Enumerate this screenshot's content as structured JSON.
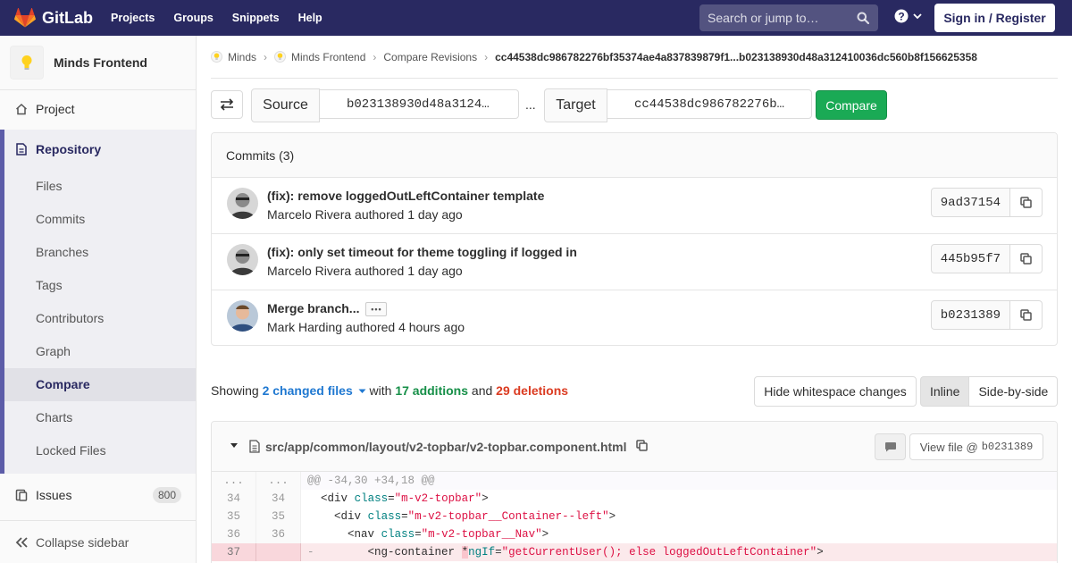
{
  "nav": {
    "brand": "GitLab",
    "links": [
      "Projects",
      "Groups",
      "Snippets",
      "Help"
    ],
    "search_placeholder": "Search or jump to…",
    "signin": "Sign in / Register"
  },
  "sidebar": {
    "project_name": "Minds Frontend",
    "project": "Project",
    "repository": "Repository",
    "repo_items": [
      "Files",
      "Commits",
      "Branches",
      "Tags",
      "Contributors",
      "Graph",
      "Compare",
      "Charts",
      "Locked Files"
    ],
    "active_item": "Compare",
    "issues": "Issues",
    "issues_count": "800",
    "collapse": "Collapse sidebar"
  },
  "breadcrumb": {
    "items": [
      "Minds",
      "Minds Frontend",
      "Compare Revisions"
    ],
    "current": "cc44538dc986782276bf35374ae4a837839879f1...b023138930d48a312410036dc560b8f156625358"
  },
  "compare": {
    "source_label": "Source",
    "source_value": "b023138930d48a3124…",
    "separator": "...",
    "target_label": "Target",
    "target_value": "cc44538dc986782276b…",
    "button": "Compare"
  },
  "commits": {
    "header": "Commits (3)",
    "items": [
      {
        "title": "(fix): remove loggedOutLeftContainer template",
        "author": "Marcelo Rivera",
        "meta": "authored 1 day ago",
        "sha": "9ad37154"
      },
      {
        "title": "(fix): only set timeout for theme toggling if logged in",
        "author": "Marcelo Rivera",
        "meta": "authored 1 day ago",
        "sha": "445b95f7"
      },
      {
        "title": "Merge branch...",
        "author": "Mark Harding",
        "meta": "authored 4 hours ago",
        "sha": "b0231389"
      }
    ]
  },
  "summary": {
    "showing": "Showing",
    "files": "2 changed files",
    "with": "with",
    "additions": "17 additions",
    "and": "and",
    "deletions": "29 deletions"
  },
  "toolbar": {
    "hide_whitespace": "Hide whitespace changes",
    "inline": "Inline",
    "side_by_side": "Side-by-side"
  },
  "file": {
    "path": "src/app/common/layout/v2-topbar/v2-topbar.component.html",
    "view_file": "View file @",
    "view_sha": "b0231389"
  },
  "diff": {
    "hunk": "@@ -34,30 +34,18 @@",
    "hunk_old": "...",
    "hunk_new": "...",
    "lines": [
      {
        "old": "34",
        "new": "34",
        "indent": "  ",
        "tag": "div",
        "attr": "class",
        "val": "\"m-v2-topbar\""
      },
      {
        "old": "35",
        "new": "35",
        "indent": "    ",
        "tag": "div",
        "attr": "class",
        "val": "\"m-v2-topbar__Container--left\""
      },
      {
        "old": "36",
        "new": "36",
        "indent": "      ",
        "tag": "nav",
        "attr": "class",
        "val": "\"m-v2-topbar__Nav\""
      }
    ],
    "deleted": {
      "old": "37",
      "marker": "-",
      "indent": "        ",
      "tag": "ng-container",
      "star": "*",
      "attr": "ngIf",
      "val": "\"getCurrentUser(); else loggedOutLeftContainer\""
    }
  },
  "colors": {
    "navbar": "#292961",
    "accent": "#1aaa55",
    "additions": "#168f48",
    "deletions": "#db3b21",
    "link": "#1f78d1"
  }
}
